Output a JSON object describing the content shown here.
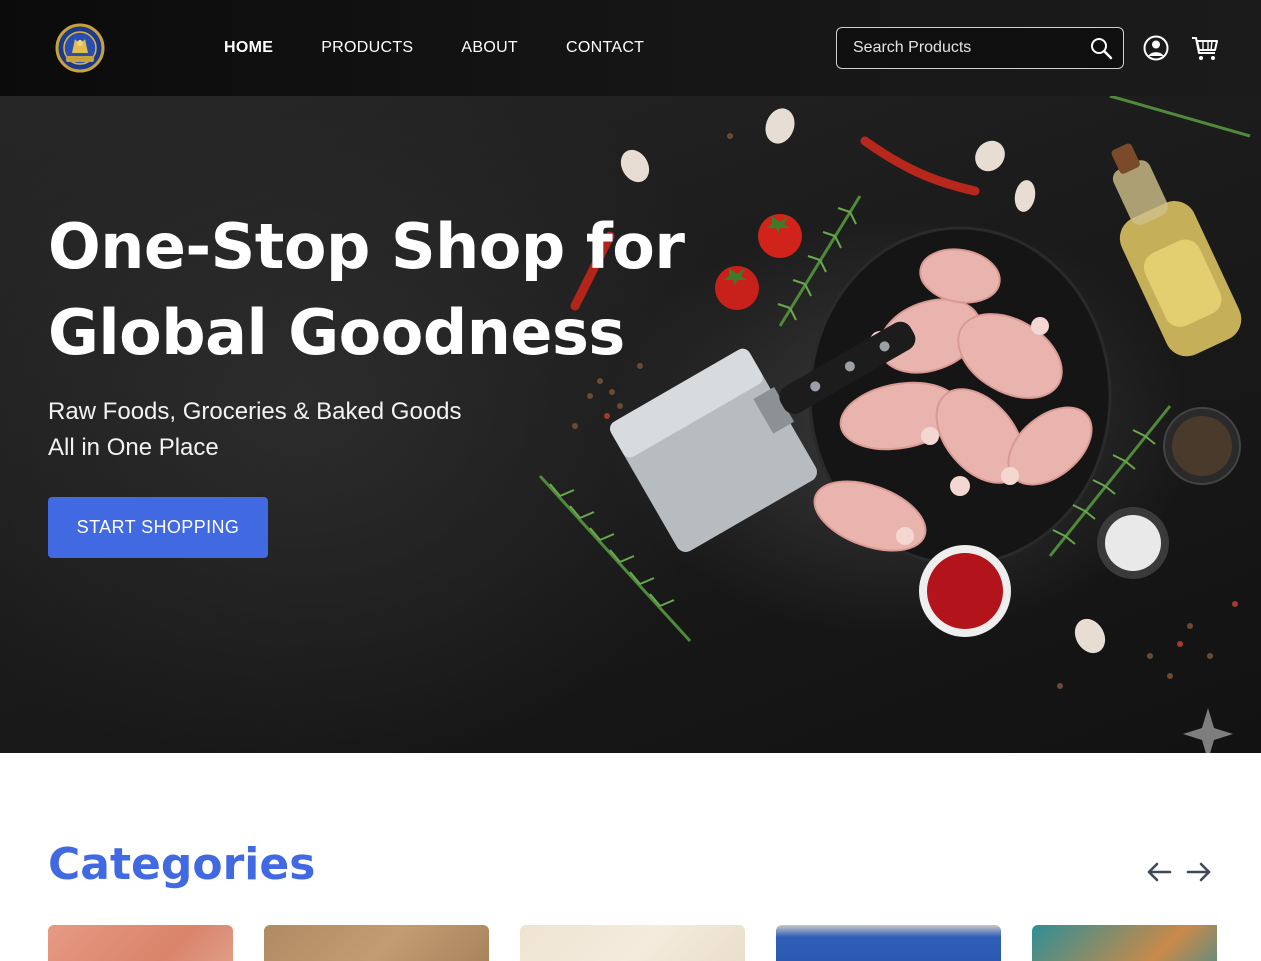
{
  "header": {
    "logo_icon": "crest-logo-icon",
    "nav": [
      {
        "label": "HOME",
        "active": true
      },
      {
        "label": "PRODUCTS",
        "active": false
      },
      {
        "label": "ABOUT",
        "active": false
      },
      {
        "label": "CONTACT",
        "active": false
      }
    ],
    "search": {
      "placeholder": "Search Products",
      "icon": "search-icon"
    },
    "account_icon": "user-circle-icon",
    "cart_icon": "cart-icon"
  },
  "hero": {
    "title_line1": "One-Stop Shop for",
    "title_line2": "Global Goodness",
    "subtitle_line1": "Raw Foods, Groceries & Baked Goods",
    "subtitle_line2": "All in One Place",
    "cta_label": "START SHOPPING"
  },
  "categories": {
    "title": "Categories",
    "prev_icon": "arrow-left-icon",
    "next_icon": "arrow-right-icon",
    "cards": [
      {
        "name": "category-card-1"
      },
      {
        "name": "category-card-2"
      },
      {
        "name": "category-card-3"
      },
      {
        "name": "category-card-4"
      },
      {
        "name": "category-card-5"
      }
    ]
  },
  "colors": {
    "accent": "#4169e1",
    "header_bg": "#111111",
    "hero_text": "#ffffff"
  }
}
